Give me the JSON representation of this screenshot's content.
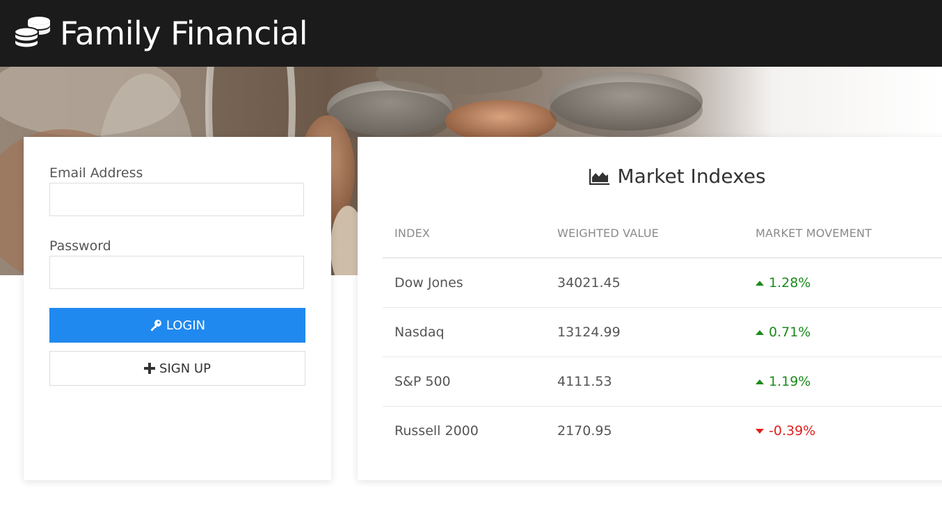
{
  "header": {
    "title": "Family Financial",
    "icon": "coins-icon"
  },
  "login": {
    "email_label": "Email Address",
    "email_value": "",
    "password_label": "Password",
    "password_value": "",
    "login_label": "LOGIN",
    "login_icon": "key-icon",
    "signup_label": "SIGN UP",
    "signup_icon": "plus-icon"
  },
  "market": {
    "title": "Market Indexes",
    "title_icon": "area-chart-icon",
    "columns": [
      "INDEX",
      "WEIGHTED VALUE",
      "MARKET MOVEMENT"
    ],
    "rows": [
      {
        "index": "Dow Jones",
        "value": "34021.45",
        "movement": "1.28%",
        "direction": "up"
      },
      {
        "index": "Nasdaq",
        "value": "13124.99",
        "movement": "0.71%",
        "direction": "up"
      },
      {
        "index": "S&P 500",
        "value": "4111.53",
        "movement": "1.19%",
        "direction": "up"
      },
      {
        "index": "Russell 2000",
        "value": "2170.95",
        "movement": "-0.39%",
        "direction": "down"
      }
    ]
  },
  "colors": {
    "header_bg": "#1b1b1b",
    "primary_button": "#2089ef",
    "up": "#1b8a1b",
    "down": "#e0201e"
  }
}
